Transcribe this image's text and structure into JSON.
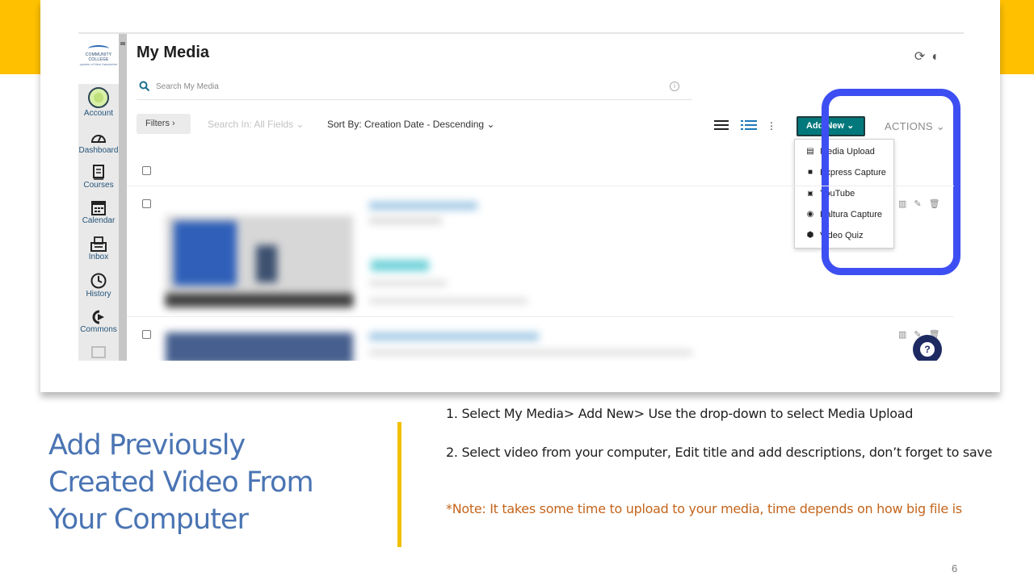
{
  "colors": {
    "accent_yellow": "#ffc000",
    "title_blue": "#4a74b3",
    "note_orange": "#c4651c",
    "add_new_teal": "#00787c",
    "highlight_blue": "#3d4ff2"
  },
  "app": {
    "page_title": "My Media",
    "logo": {
      "line1": "COMMUNITY COLLEGE",
      "line2": "system of New Hampshire"
    },
    "nav": [
      {
        "label": "Account",
        "icon": "avatar-icon"
      },
      {
        "label": "Dashboard",
        "icon": "dashboard-icon"
      },
      {
        "label": "Courses",
        "icon": "courses-icon"
      },
      {
        "label": "Calendar",
        "icon": "calendar-icon"
      },
      {
        "label": "Inbox",
        "icon": "inbox-icon"
      },
      {
        "label": "History",
        "icon": "history-icon"
      },
      {
        "label": "Commons",
        "icon": "commons-icon"
      }
    ],
    "search": {
      "placeholder": "Search My Media"
    },
    "toolbar": {
      "filters_label": "Filters",
      "search_in_label": "Search In: All Fields",
      "sort_by_label": "Sort By: Creation Date - Descending",
      "add_new_label": "Add New",
      "actions_label": "ACTIONS"
    },
    "add_new_menu": [
      {
        "label": "Media Upload",
        "icon": "film-icon"
      },
      {
        "label": "Express Capture",
        "icon": "camera-icon"
      },
      {
        "label": "YouTube",
        "icon": "youtube-icon"
      },
      {
        "label": "Kaltura Capture",
        "icon": "record-icon"
      },
      {
        "label": "Video Quiz",
        "icon": "cube-icon"
      }
    ]
  },
  "slide": {
    "title": "Add Previously Created Video From Your Computer",
    "step1": "1. Select My Media> Add New> Use the drop-down to select Media Upload",
    "step2": "2. Select video from your computer, Edit title and add descriptions, don’t forget to save",
    "note": "*Note: It takes some time to upload to your media, time depends on how big file is",
    "page_number": "6"
  }
}
